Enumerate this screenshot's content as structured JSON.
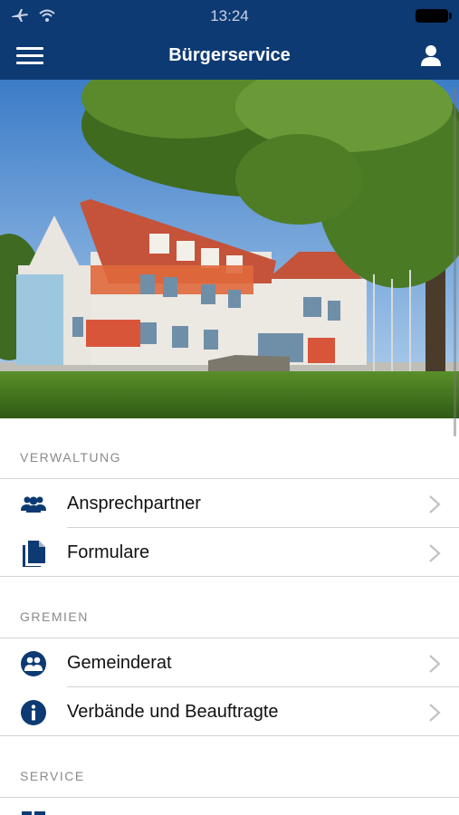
{
  "status_bar": {
    "time": "13:24"
  },
  "header": {
    "title": "Bürgerservice"
  },
  "sections": [
    {
      "title": "VERWALTUNG",
      "items": [
        {
          "label": "Ansprechpartner",
          "icon": "people-icon"
        },
        {
          "label": "Formulare",
          "icon": "document-icon"
        }
      ]
    },
    {
      "title": "GREMIEN",
      "items": [
        {
          "label": "Gemeinderat",
          "icon": "council-icon"
        },
        {
          "label": "Verbände und Beauftragte",
          "icon": "info-icon"
        }
      ]
    },
    {
      "title": "SERVICE",
      "items": [
        {
          "label": "",
          "icon": "book-icon"
        }
      ]
    }
  ],
  "colors": {
    "navy": "#0d3a73",
    "icon_blue": "#0d3a73",
    "separator": "#d2d2d6"
  }
}
